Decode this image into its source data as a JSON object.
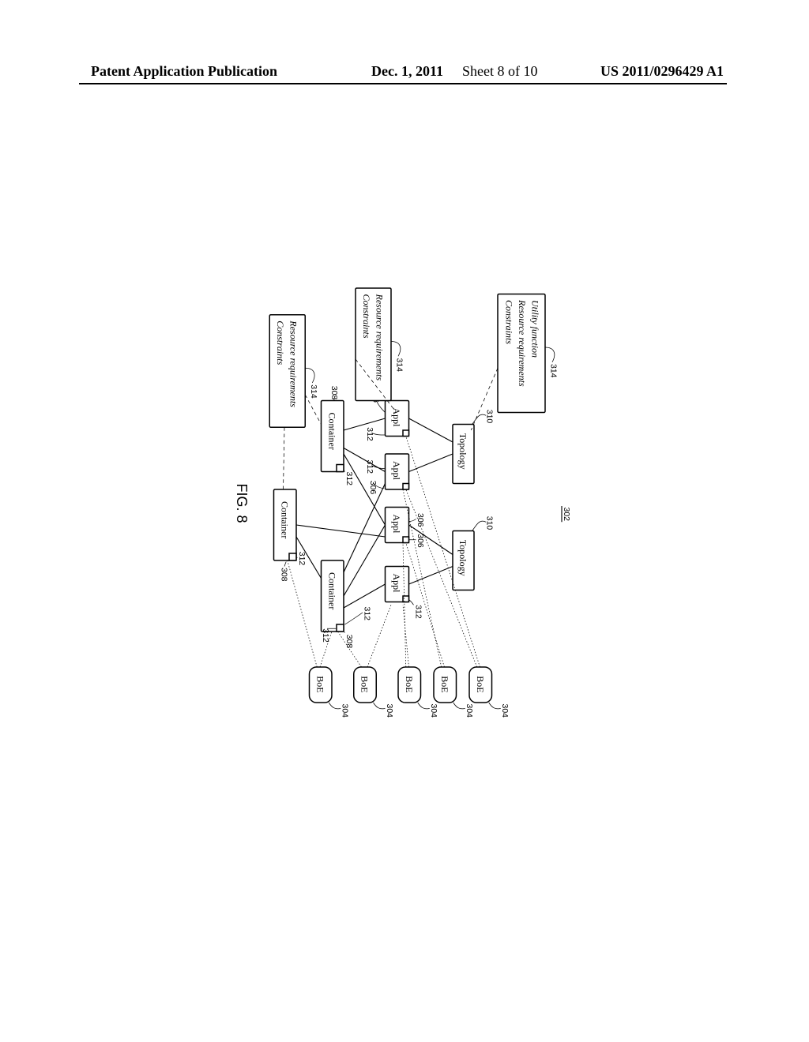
{
  "header": {
    "left": "Patent Application Publication",
    "date": "Dec. 1, 2011",
    "sheet": "Sheet 8 of 10",
    "pubno": "US 2011/0296429 A1"
  },
  "figure": {
    "caption": "FIG. 8",
    "ref302": "302",
    "box314a": {
      "line1": "Utility function",
      "line2": "Resource requirements",
      "line3": "Constraints",
      "num": "314"
    },
    "box314b": {
      "line1": "Resource requirements",
      "line2": "Constraints",
      "num": "314"
    },
    "box314c": {
      "line1": "Resource requirements",
      "line2": "Constraints",
      "num": "314"
    },
    "topologyA": {
      "label": "Topology",
      "num": "310"
    },
    "topologyB": {
      "label": "Topology",
      "num": "310"
    },
    "appl": {
      "label": "Appl",
      "num306": "306",
      "num312": "312"
    },
    "container": {
      "label": "Container",
      "num308": "308",
      "num312": "312"
    },
    "boe": {
      "label": "BoE",
      "num304": "304"
    }
  }
}
